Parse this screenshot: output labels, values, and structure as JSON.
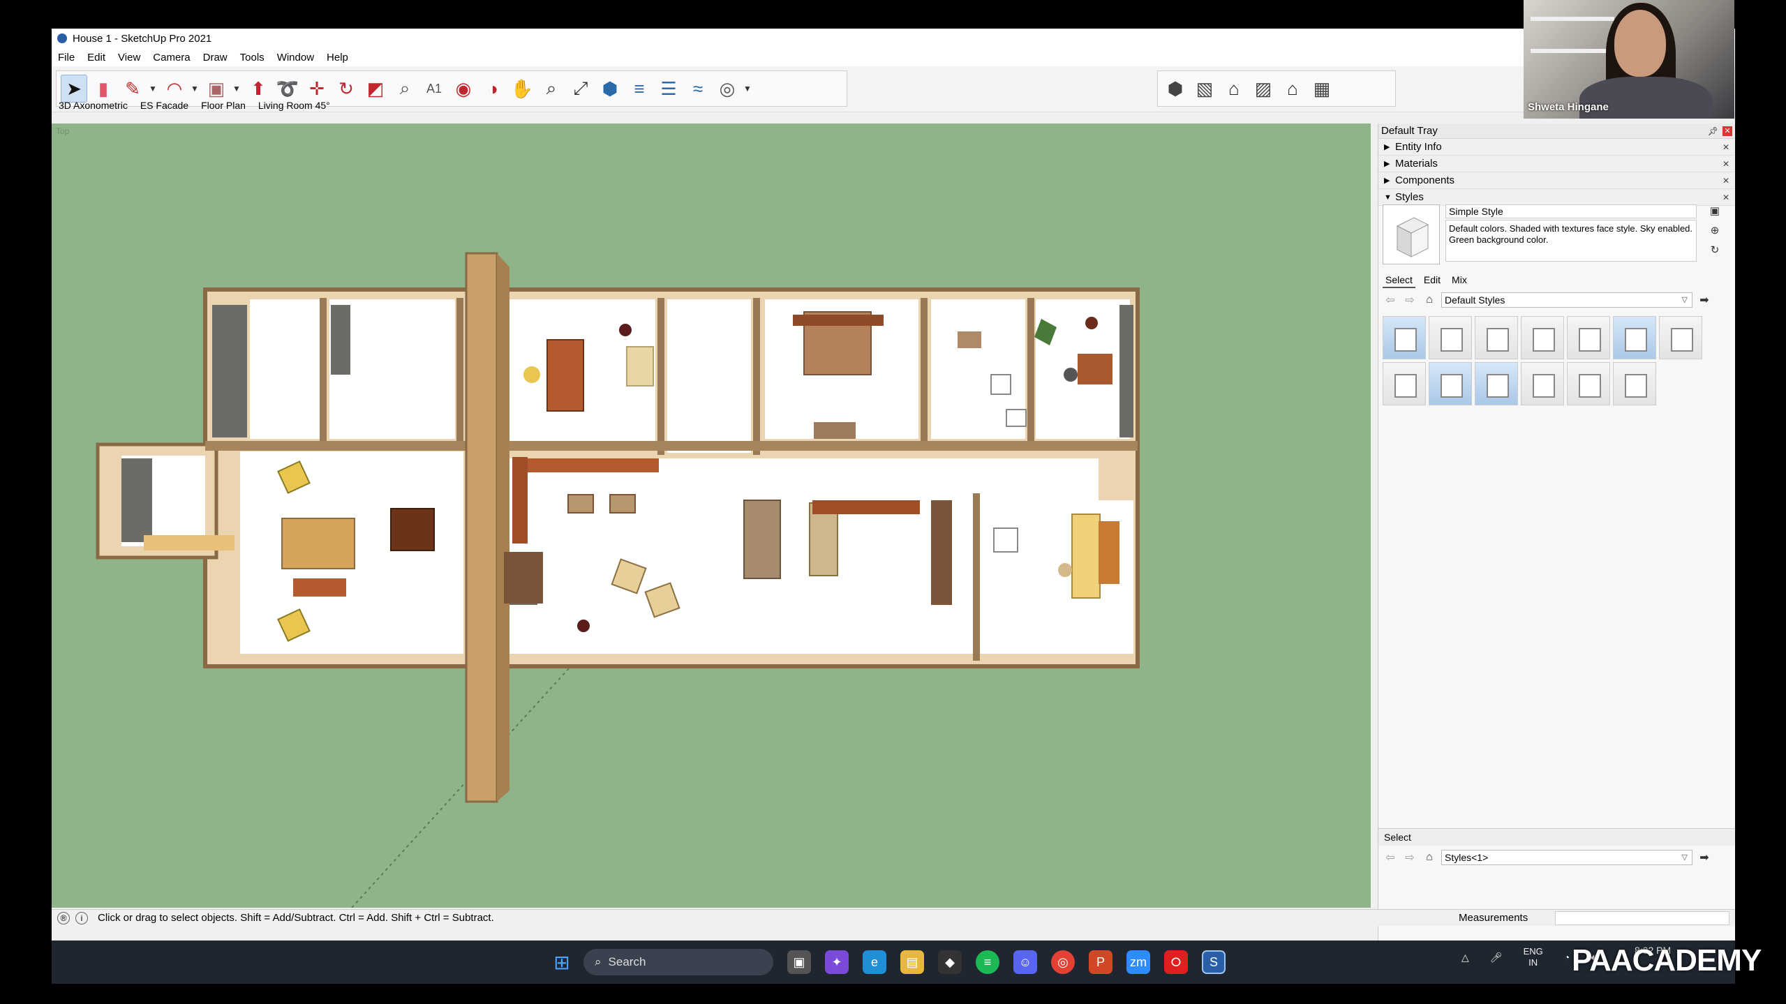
{
  "window": {
    "title": "House 1 - SketchUp Pro 2021"
  },
  "menu": [
    "File",
    "Edit",
    "View",
    "Camera",
    "Draw",
    "Tools",
    "Window",
    "Help"
  ],
  "scenes": [
    "3D Axonometric",
    "ES Facade",
    "Floor Plan",
    "Living Room 45°"
  ],
  "viewport": {
    "view_label": "Top",
    "background": "#8fb48a"
  },
  "tray": {
    "title": "Default Tray",
    "panels": [
      {
        "label": "Entity Info",
        "expanded": false
      },
      {
        "label": "Materials",
        "expanded": false
      },
      {
        "label": "Components",
        "expanded": false
      },
      {
        "label": "Styles",
        "expanded": true
      }
    ],
    "style": {
      "name": "Simple Style",
      "description": "Default colors.  Shaded with textures face style.  Sky enabled.  Green background color."
    },
    "style_tabs": [
      "Select",
      "Edit",
      "Mix"
    ],
    "library": "Default Styles",
    "select_section": {
      "title": "Select",
      "library": "Styles<1>"
    }
  },
  "statusbar": {
    "hint": "Click or drag to select objects. Shift = Add/Subtract. Ctrl = Add. Shift + Ctrl = Subtract.",
    "measurements_label": "Measurements"
  },
  "taskbar": {
    "search_placeholder": "Search",
    "language": "ENG",
    "region": "IN",
    "time": "8:32 PM"
  },
  "webcam": {
    "name": "Shweta Hingane"
  },
  "watermark": "PAACADEMY",
  "icons": {
    "toolbar": [
      "select-icon",
      "eraser-icon",
      "pencil-icon",
      "arc-icon",
      "rectangle-icon",
      "push-pull-icon",
      "follow-me-icon",
      "move-icon",
      "rotate-icon",
      "scale-icon",
      "tape-measure-icon",
      "text-icon",
      "paint-bucket-icon",
      "orbit-icon",
      "pan-icon",
      "zoom-icon",
      "zoom-extents-icon",
      "warehouse-icon",
      "extension-icon",
      "layers-icon",
      "sandbox-icon",
      "account-icon"
    ],
    "views": [
      "iso-view-icon",
      "top-view-icon",
      "front-view-icon",
      "right-view-icon",
      "back-view-icon",
      "left-view-icon"
    ]
  }
}
